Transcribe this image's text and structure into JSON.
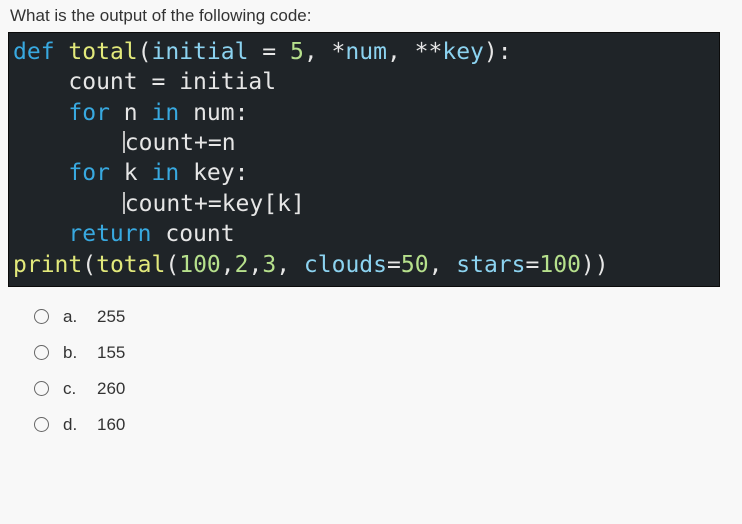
{
  "question": "What is the output of the following code:",
  "code": {
    "l1": {
      "kw1": "def",
      "fn": "total",
      "p1": "(",
      "var1": "initial",
      "eq": " = ",
      "num1": "5",
      "c1": ", *",
      "var2": "num",
      "c2": ", **",
      "var3": "key",
      "p2": "):"
    },
    "l2": {
      "pad": "    ",
      "var": "count",
      "mid": " = ",
      "rhs": "initial"
    },
    "l3": {
      "pad": "    ",
      "kw1": "for",
      "sp1": " ",
      "var1": "n",
      "sp2": " ",
      "kw2": "in",
      "sp3": " ",
      "var2": "num",
      "colon": ":"
    },
    "l4": {
      "pad": "        ",
      "txt": "count+=n"
    },
    "l5": {
      "pad": "    ",
      "kw1": "for",
      "sp1": " ",
      "var1": "k",
      "sp2": " ",
      "kw2": "in",
      "sp3": " ",
      "var2": "key",
      "colon": ":"
    },
    "l6": {
      "pad": "        ",
      "txt": "count+=key[k]"
    },
    "l7": {
      "pad": "    ",
      "kw": "return",
      "sp": " ",
      "var": "count"
    },
    "l8": {
      "fn": "print",
      "p1": "(",
      "fn2": "total",
      "p2": "(",
      "n1": "100",
      "c1": ",",
      "n2": "2",
      "c2": ",",
      "n3": "3",
      "c3": ", ",
      "k1": "clouds",
      "eq1": "=",
      "n4": "50",
      "c4": ", ",
      "k2": "stars",
      "eq2": "=",
      "n5": "100",
      "p3": "))"
    }
  },
  "options": [
    {
      "letter": "a.",
      "text": "255"
    },
    {
      "letter": "b.",
      "text": "155"
    },
    {
      "letter": "c.",
      "text": "260"
    },
    {
      "letter": "d.",
      "text": "160"
    }
  ]
}
